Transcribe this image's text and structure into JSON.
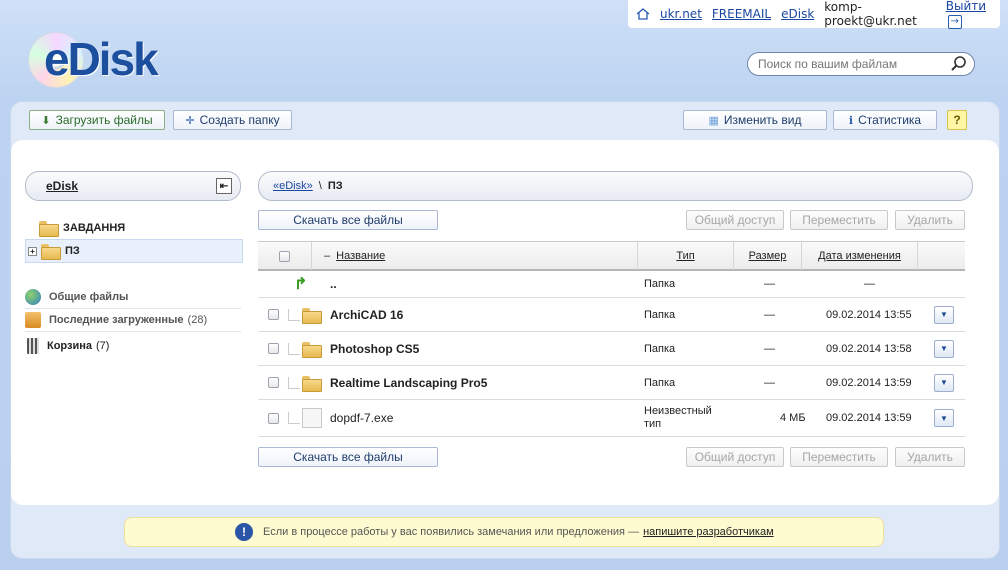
{
  "topbar": {
    "links": [
      "ukr.net",
      "FREEMAIL",
      "eDisk"
    ],
    "email": "komp-proekt@ukr.net",
    "logout": "Выйти"
  },
  "logo": {
    "text": "eDisk"
  },
  "search": {
    "placeholder": "Поиск по вашим файлам"
  },
  "toolbar": {
    "upload": "Загрузить файлы",
    "create_folder": "Создать папку",
    "change_view": "Изменить вид",
    "stats": "Статистика",
    "help": "?"
  },
  "sidebar": {
    "title": "eDisk",
    "folders": [
      "ЗАВДАННЯ",
      "ПЗ"
    ],
    "shared": "Общие файлы",
    "recent": "Последние загруженные",
    "recent_count": "(28)",
    "trash": "Корзина",
    "trash_count": "(7)"
  },
  "breadcrumb": {
    "root": "«eDisk»",
    "sep": "\\",
    "current": "ПЗ"
  },
  "actions": {
    "download_all": "Скачать все файлы",
    "share": "Общий доступ",
    "move": "Переместить",
    "delete": "Удалить"
  },
  "table": {
    "headers": {
      "sort": "–",
      "name": "Название",
      "type": "Тип",
      "size": "Размер",
      "date": "Дата изменения"
    },
    "up_row": {
      "name": "..",
      "type": "Папка",
      "size": "—",
      "date": "—"
    },
    "rows": [
      {
        "name": "ArchiCAD 16",
        "type": "Папка",
        "size": "—",
        "date": "09.02.2014 13:55",
        "kind": "folder"
      },
      {
        "name": "Photoshop CS5",
        "type": "Папка",
        "size": "—",
        "date": "09.02.2014 13:58",
        "kind": "folder"
      },
      {
        "name": "Realtime Landscaping Pro5",
        "type": "Папка",
        "size": "—",
        "date": "09.02.2014 13:59",
        "kind": "folder"
      },
      {
        "name": "dopdf-7.exe",
        "type": "Неизвестный тип",
        "size": "4 МБ",
        "date": "09.02.2014 13:59",
        "kind": "file"
      }
    ]
  },
  "notice": {
    "text": "Если в процессе работы у вас появились замечания или предложения —",
    "link": "напишите разработчикам"
  },
  "colors": {
    "accent": "#1d4f9f",
    "frame": "#dfe9f7",
    "notice_bg": "#fffbd0"
  }
}
